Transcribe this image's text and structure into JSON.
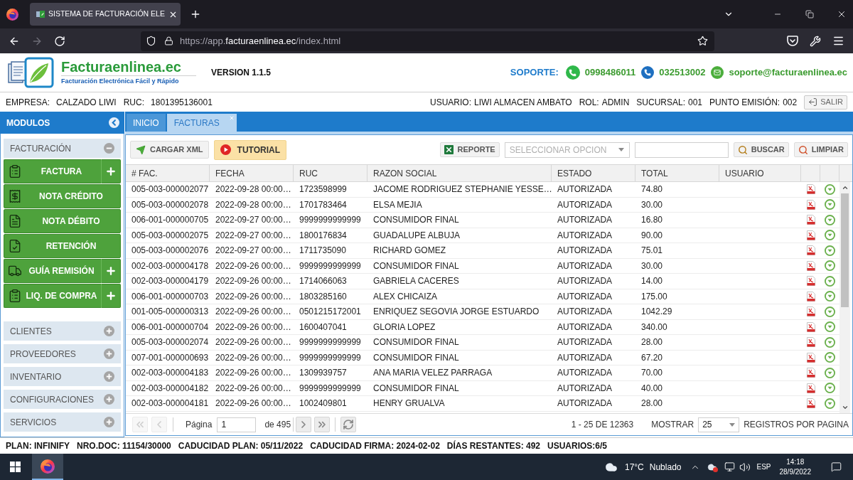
{
  "browser": {
    "tab_title": "SISTEMA DE FACTURACIÓN ELE",
    "nav_buttons": [
      {
        "kind": "back",
        "disabled": false
      },
      {
        "kind": "forward",
        "disabled": true
      },
      {
        "kind": "reload",
        "disabled": false
      }
    ],
    "address": [
      {
        "text": "https://app.",
        "highlighted": false
      },
      {
        "text": "facturaenlinea.ec",
        "highlighted": true
      },
      {
        "text": "/index.html",
        "highlighted": false
      }
    ]
  },
  "header": {
    "brand": {
      "name": "Facturaenlinea.ec",
      "tagline": "Facturación Electrónica Fácil y Rápido"
    },
    "version": "VERSION 1.1.5",
    "support": {
      "label": "SOPORTE:",
      "contacts": [
        {
          "kind": "chat",
          "text": "0998486011"
        },
        {
          "kind": "phone",
          "text": "032513002"
        },
        {
          "kind": "email",
          "text": "soporte@facturaenlinea.ec"
        }
      ]
    }
  },
  "info_bar": {
    "company": [
      {
        "label": "EMPRESA:",
        "value": "CALZADO LIWI"
      },
      {
        "label": "RUC:",
        "value": "1801395136001"
      }
    ],
    "session": [
      {
        "label": "USUARIO:",
        "value": "LIWI ALMACEN AMBATO"
      },
      {
        "label": "ROL:",
        "value": "ADMIN"
      },
      {
        "label": "SUCURSAL:",
        "value": "001"
      },
      {
        "label": "PUNTO EMISIÓN:",
        "value": "002"
      }
    ],
    "logout_button": "SALIR"
  },
  "sidebar": {
    "title": "MODULOS",
    "sections": [
      {
        "label": "FACTURACIÓN",
        "expanded": true,
        "items": [
          {
            "label": "FACTURA",
            "kind": "invoice",
            "has_add": true
          },
          {
            "label": "NOTA CRÉDITO",
            "kind": "credit-note",
            "has_add": false
          },
          {
            "label": "NOTA DÉBITO",
            "kind": "debit-note",
            "has_add": false
          },
          {
            "label": "RETENCIÓN",
            "kind": "withholding",
            "has_add": false
          },
          {
            "label": "GUÍA REMISIÓN",
            "kind": "shipping",
            "has_add": true
          },
          {
            "label": "LIQ. DE COMPRA",
            "kind": "purchase",
            "has_add": true
          }
        ]
      },
      {
        "label": "CLIENTES",
        "expanded": false
      },
      {
        "label": "PROVEEDORES",
        "expanded": false
      },
      {
        "label": "INVENTARIO",
        "expanded": false
      },
      {
        "label": "CONFIGURACIONES",
        "expanded": false
      },
      {
        "label": "SERVICIOS",
        "expanded": false
      }
    ]
  },
  "tabs": [
    {
      "label": "INICIO",
      "selected": false,
      "closable": false
    },
    {
      "label": "FACTURAS",
      "selected": true,
      "closable": true
    }
  ],
  "toolbar": {
    "upload_button": "CARGAR XML",
    "tutorial_button": "TUTORIAL",
    "report_button": "REPORTE",
    "select": {
      "placeholder": "SELECCIONAR OPCION"
    },
    "search_button": "BUSCAR",
    "clear_button": "LIMPIAR"
  },
  "table": {
    "columns": [
      "# FAC.",
      "FECHA",
      "RUC",
      "RAZON SOCIAL",
      "ESTADO",
      "TOTAL",
      "USUARIO"
    ],
    "rows": [
      {
        "cells": [
          "005-003-000002077",
          "2022-09-28 00:00…",
          "1723598999",
          "JACOME RODRIGUEZ STEPHANIE YESSE…",
          "AUTORIZADA",
          "74.80"
        ]
      },
      {
        "cells": [
          "005-003-000002078",
          "2022-09-28 00:00…",
          "1701783464",
          "ELSA MEJIA",
          "AUTORIZADA",
          "30.00"
        ]
      },
      {
        "cells": [
          "006-001-000000705",
          "2022-09-27 00:00…",
          "9999999999999",
          "CONSUMIDOR FINAL",
          "AUTORIZADA",
          "16.80"
        ]
      },
      {
        "cells": [
          "005-003-000002075",
          "2022-09-27 00:00…",
          "1800176834",
          "GUADALUPE ALBUJA",
          "AUTORIZADA",
          "90.00"
        ]
      },
      {
        "cells": [
          "005-003-000002076",
          "2022-09-27 00:00…",
          "1711735090",
          "RICHARD GOMEZ",
          "AUTORIZADA",
          "75.01"
        ]
      },
      {
        "cells": [
          "002-003-000004178",
          "2022-09-26 00:00…",
          "9999999999999",
          "CONSUMIDOR FINAL",
          "AUTORIZADA",
          "30.00"
        ]
      },
      {
        "cells": [
          "002-003-000004179",
          "2022-09-26 00:00…",
          "1714066063",
          "GABRIELA CACERES",
          "AUTORIZADA",
          "14.00"
        ]
      },
      {
        "cells": [
          "006-001-000000703",
          "2022-09-26 00:00…",
          "1803285160",
          "ALEX CHICAIZA",
          "AUTORIZADA",
          "175.00"
        ]
      },
      {
        "cells": [
          "001-005-000000313",
          "2022-09-26 00:00…",
          "0501215172001",
          "ENRIQUEZ SEGOVIA JORGE ESTUARDO",
          "AUTORIZADA",
          "1042.29"
        ]
      },
      {
        "cells": [
          "006-001-000000704",
          "2022-09-26 00:00…",
          "1600407041",
          "GLORIA LOPEZ",
          "AUTORIZADA",
          "340.00"
        ]
      },
      {
        "cells": [
          "005-003-000002074",
          "2022-09-26 00:00…",
          "9999999999999",
          "CONSUMIDOR FINAL",
          "AUTORIZADA",
          "28.00"
        ]
      },
      {
        "cells": [
          "007-001-000000693",
          "2022-09-26 00:00…",
          "9999999999999",
          "CONSUMIDOR FINAL",
          "AUTORIZADA",
          "67.20"
        ]
      },
      {
        "cells": [
          "002-003-000004183",
          "2022-09-26 00:00…",
          "1309939757",
          "ANA MARIA VELEZ PARRAGA",
          "AUTORIZADA",
          "70.00"
        ]
      },
      {
        "cells": [
          "002-003-000004182",
          "2022-09-26 00:00…",
          "9999999999999",
          "CONSUMIDOR FINAL",
          "AUTORIZADA",
          "40.00"
        ]
      },
      {
        "cells": [
          "002-003-000004181",
          "2022-09-26 00:00…",
          "1002409801",
          "HENRY GRUALVA",
          "AUTORIZADA",
          "28.00"
        ]
      }
    ]
  },
  "pager": {
    "buttons": [
      {
        "kind": "first",
        "disabled": true
      },
      {
        "kind": "prev",
        "disabled": true
      },
      {
        "kind": "next",
        "disabled": false
      },
      {
        "kind": "last",
        "disabled": false
      },
      {
        "kind": "refresh",
        "disabled": false
      }
    ],
    "page_label": "Página",
    "page_value": "1",
    "page_total": "de 495",
    "range": "1 - 25 DE 12363",
    "show_label": "MOSTRAR",
    "page_size": "25",
    "per_page_label": "REGISTROS POR PAGINA"
  },
  "status_bar": [
    "PLAN: INFINIFY",
    "NRO.DOC: 11154/30000",
    "CADUCIDAD PLAN: 05/11/2022",
    "CADUCIDAD FIRMA: 2024-02-02",
    "DÍAS RESTANTES: 492",
    "USUARIOS:6/5"
  ],
  "taskbar": {
    "weather": {
      "temperature": "17°C",
      "condition": "Nublado"
    },
    "language": "ESP",
    "time": "14:18",
    "date": "28/9/2022"
  }
}
